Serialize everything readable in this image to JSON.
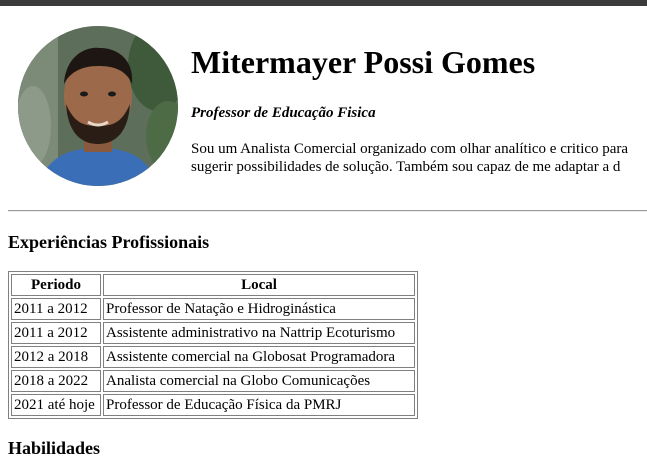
{
  "profile": {
    "name": "Mitermayer Possi Gomes",
    "role": "Professor de Educação Fisica",
    "bio_line1": "Sou um Analista Comercial organizado com olhar analítico e critico para",
    "bio_line2": "sugerir possibilidades de solução. Também sou capaz de me adaptar a d",
    "photo": "profile-photo"
  },
  "experience": {
    "title": "Experiências Profissionais",
    "columns": [
      "Periodo",
      "Local"
    ],
    "rows": [
      {
        "periodo": "2011 a 2012",
        "local": "Professor de Natação e Hidroginástica"
      },
      {
        "periodo": "2011 a 2012",
        "local": "Assistente administrativo na Nattrip Ecoturismo"
      },
      {
        "periodo": "2012 a 2018",
        "local": "Assistente comercial na Globosat Programadora"
      },
      {
        "periodo": "2018 a 2022",
        "local": "Analista comercial na Globo Comunicações"
      },
      {
        "periodo": "2021 até hoje",
        "local": "Professor de Educação Física da PMRJ"
      }
    ]
  },
  "next_section": {
    "title": "Habilidades"
  },
  "colors": {
    "topbar": "#3b3b3b",
    "border": "#808080",
    "text": "#000000"
  }
}
